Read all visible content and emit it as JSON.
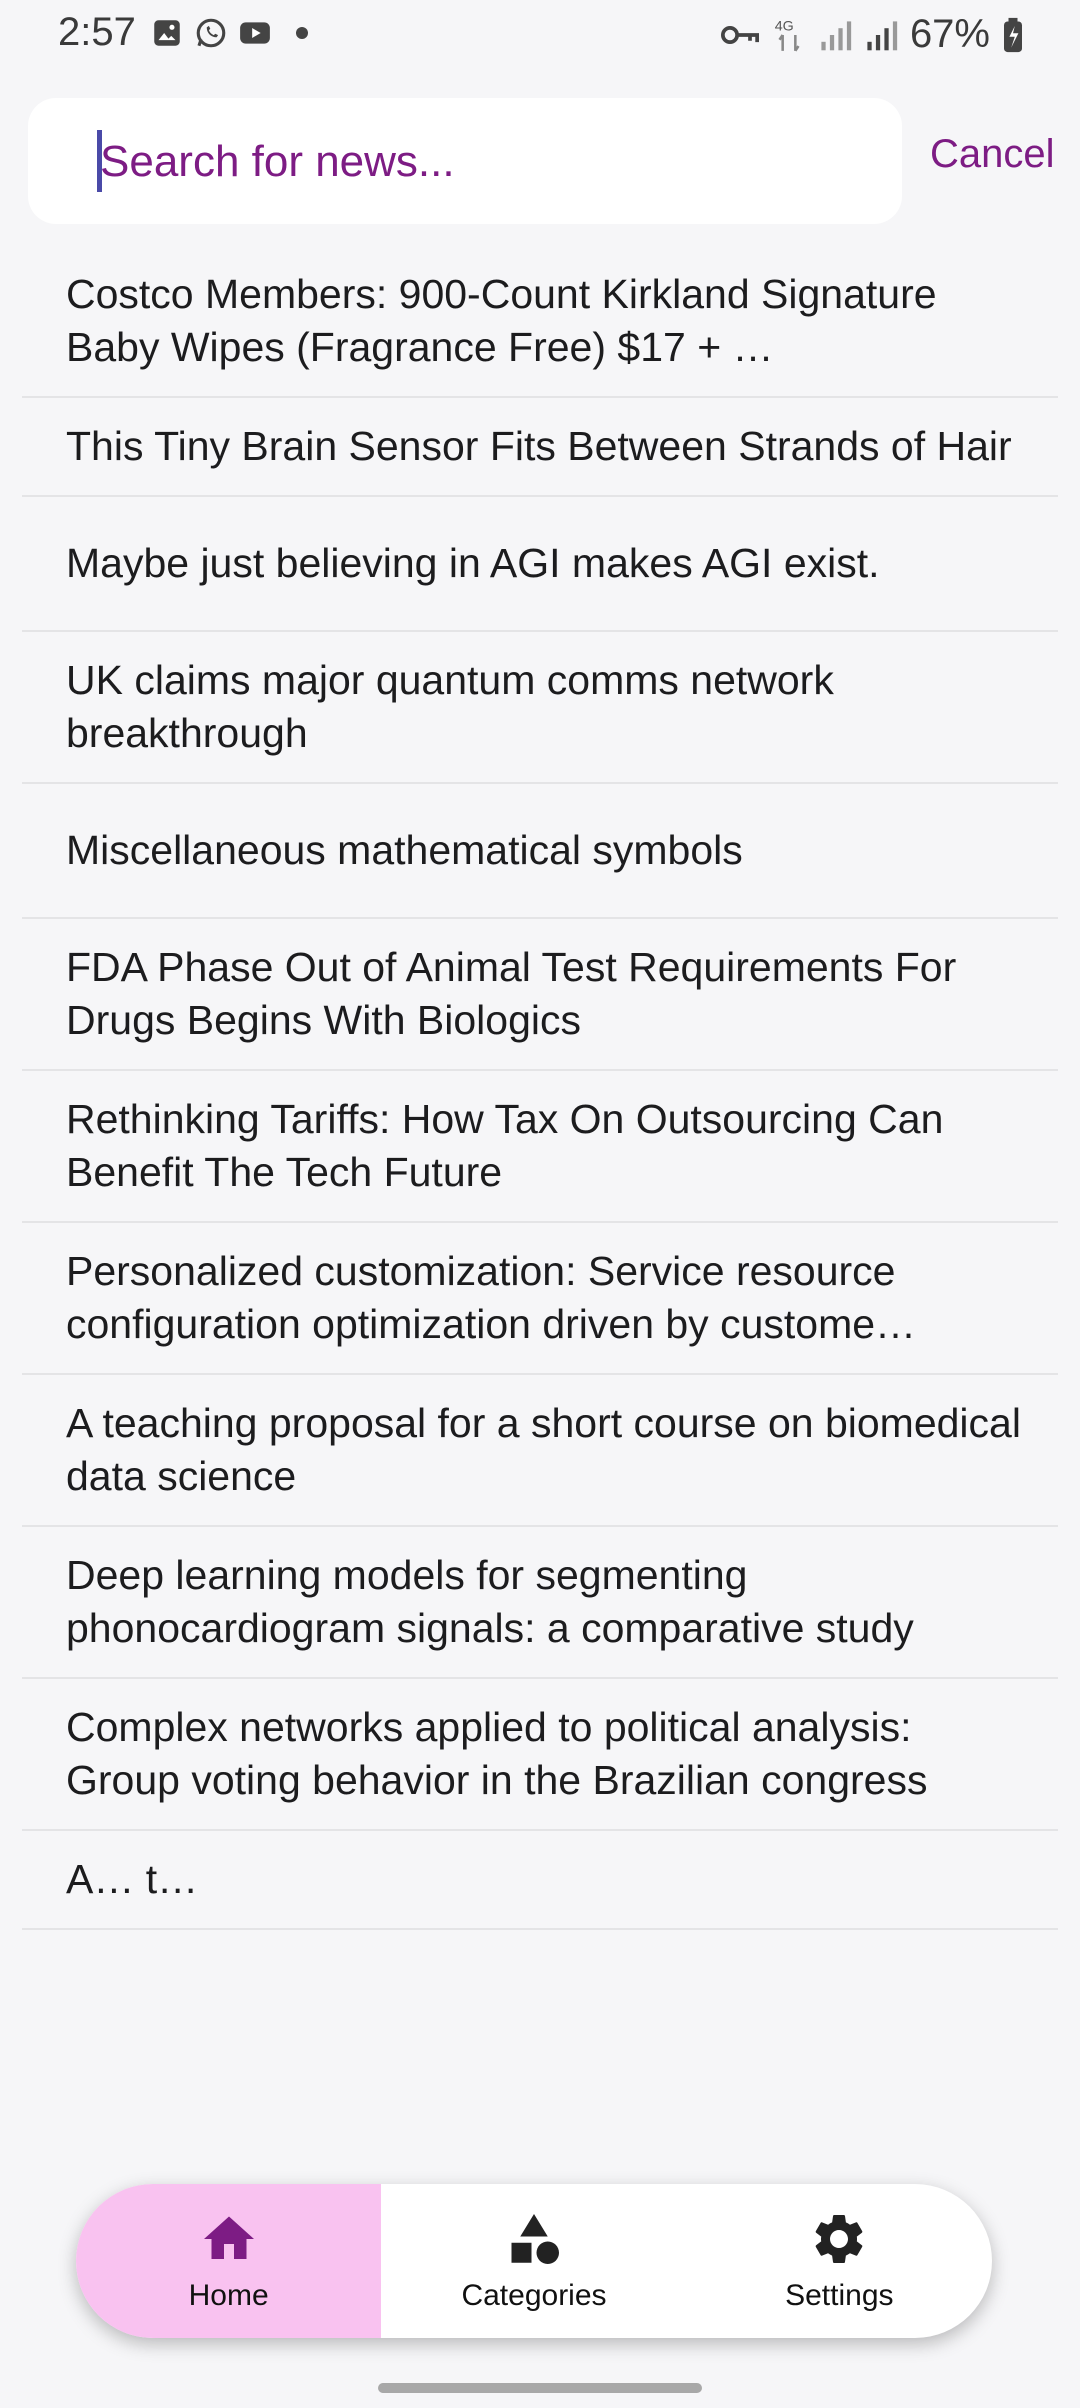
{
  "status_bar": {
    "time": "2:57",
    "battery": "67%",
    "network_label": "4G",
    "left_icons": [
      "image-icon",
      "whatsapp-icon",
      "youtube-icon",
      "dot-icon"
    ],
    "right_icons": [
      "key-icon",
      "4g-data-icon",
      "signal-icon",
      "signal-icon",
      "battery-icon"
    ]
  },
  "search": {
    "placeholder": "Search for news...",
    "value": "",
    "cancel_label": "Cancel"
  },
  "news_items": [
    "Costco Members: 900-Count Kirkland Signature Baby Wipes (Fragrance Free) $17 + …",
    "This Tiny Brain Sensor Fits Between Strands of Hair",
    "Maybe just believing in AGI makes AGI exist.",
    "UK claims major quantum comms network breakthrough",
    "Miscellaneous mathematical symbols",
    "FDA Phase Out of Animal Test Requirements For Drugs Begins With Biologics",
    "Rethinking Tariffs: How Tax On Outsourcing Can Benefit The Tech Future",
    "Personalized customization: Service resource configuration optimization driven by custome…",
    "A teaching proposal for a short course on biomedical data science",
    "Deep learning models for segmenting phonocardiogram signals: a comparative study",
    "Complex networks applied to political analysis: Group voting behavior in the Brazilian congress",
    "A… t…"
  ],
  "bottom_nav": {
    "items": [
      {
        "label": "Home",
        "icon": "home-icon",
        "active": true
      },
      {
        "label": "Categories",
        "icon": "shapes-icon",
        "active": false
      },
      {
        "label": "Settings",
        "icon": "gear-icon",
        "active": false
      }
    ]
  },
  "colors": {
    "accent": "#7d1c84",
    "active_tab_bg": "#f9c2f0",
    "background": "#f6f6f8"
  }
}
